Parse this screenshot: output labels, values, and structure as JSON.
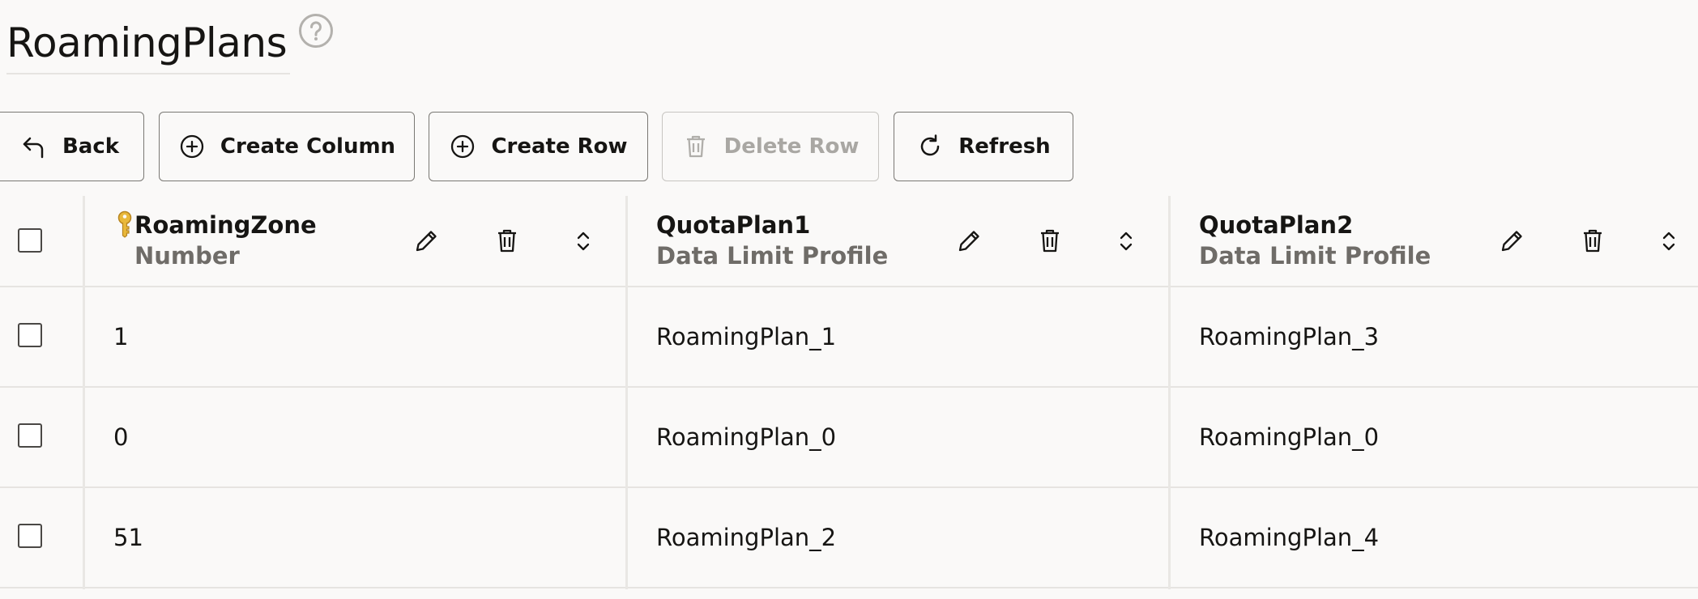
{
  "page": {
    "title": "RoamingPlans"
  },
  "toolbar": {
    "back_label": "Back",
    "create_column_label": "Create Column",
    "create_row_label": "Create Row",
    "delete_row_label": "Delete Row",
    "refresh_label": "Refresh"
  },
  "table": {
    "columns": [
      {
        "title": "RoamingZone",
        "type": "Number",
        "is_key": true
      },
      {
        "title": "QuotaPlan1",
        "type": "Data Limit Profile",
        "is_key": false
      },
      {
        "title": "QuotaPlan2",
        "type": "Data Limit Profile",
        "is_key": false
      }
    ],
    "rows": [
      [
        "1",
        "RoamingPlan_1",
        "RoamingPlan_3"
      ],
      [
        "0",
        "RoamingPlan_0",
        "RoamingPlan_0"
      ],
      [
        "51",
        "RoamingPlan_2",
        "RoamingPlan_4"
      ]
    ]
  },
  "colors": {
    "background": "#faf9f8",
    "text": "#161513",
    "muted_text": "#6f6c68",
    "disabled_text": "#a9a7a3",
    "border": "#7a7874",
    "key_icon": "#d9a52c"
  },
  "icons": {
    "help": "help-circle-icon",
    "back": "back-arrow-icon",
    "create_column": "plus-circle-icon",
    "create_row": "plus-circle-icon",
    "delete_row": "trash-icon",
    "refresh": "refresh-icon",
    "edit": "pencil-icon",
    "delete": "trash-icon",
    "sort": "sort-icon",
    "key": "key-icon"
  }
}
